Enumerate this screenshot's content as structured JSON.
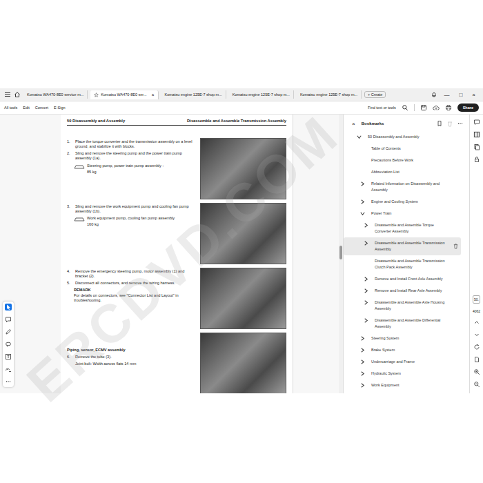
{
  "watermark": "ERCDVD.COM",
  "tabs": [
    {
      "label": "Komatsu WA470-8E0 service m...",
      "selected": false,
      "close": ""
    },
    {
      "label": "Komatsu WA470-8E0 ser...",
      "selected": true,
      "close": "×"
    },
    {
      "label": "Komatsu engine 125E-7 shop m...",
      "selected": false,
      "close": ""
    },
    {
      "label": "Komatsu engine 125E-7 shop m...",
      "selected": false,
      "close": ""
    },
    {
      "label": "Komatsu engine 125E-7 shop m...",
      "selected": false,
      "close": ""
    }
  ],
  "create": {
    "plus": "+",
    "label": "Create"
  },
  "window_controls": [
    "—",
    "□",
    "×"
  ],
  "menu": [
    "All tools",
    "Edit",
    "Convert",
    "E-Sign"
  ],
  "search": {
    "placeholder": "Find text or tools"
  },
  "share": "Share",
  "page": {
    "header_left": "50 Disassembly and Assembly",
    "header_right": "Disassemble and Assemble Transmission Assembly",
    "blocks": [
      {
        "items": [
          {
            "kind": "step",
            "num": "1.",
            "text": "Place the torque converter and the transmission assembly on a level ground, and stabilize it with blocks."
          },
          {
            "kind": "step",
            "num": "2.",
            "text": "Sling and remove the steering pump and the power train pump assembly (1a)."
          },
          {
            "kind": "weight",
            "label": "Steering pump, power train pump assembly :",
            "value": "85 kg"
          }
        ]
      },
      {
        "items": [
          {
            "kind": "step",
            "num": "3.",
            "text": "Sling and remove the work equipment pump and cooling fan pump assembly (1b)."
          },
          {
            "kind": "weight",
            "label": "Work equipment pump, cooling fan pump assembly",
            "value": "160 kg"
          }
        ]
      },
      {
        "items": [
          {
            "kind": "step",
            "num": "4.",
            "text": "Remove the emergency steering pump, motor assembly (1) and bracket (2)."
          },
          {
            "kind": "step",
            "num": "5.",
            "text": "Disconnect all connectors, and remove the wiring harness."
          },
          {
            "kind": "remark",
            "title": "REMARK",
            "text": "For details on connectors, see \"Connector List and Layout\" in troubleshooting."
          }
        ]
      },
      {
        "items": [
          {
            "kind": "heading",
            "text": "Piping, sensor, ECMV assembly"
          },
          {
            "kind": "step",
            "num": "6.",
            "text": "Remove the tube (3)."
          },
          {
            "kind": "note",
            "text": "Joint bolt: Width across flats 14 mm"
          }
        ]
      }
    ]
  },
  "bookmarks": {
    "title": "Bookmarks",
    "close": "×",
    "items": [
      {
        "label": "50 Disassembly and Assembly",
        "expandable": true,
        "expanded": true,
        "selected": false,
        "children": [
          {
            "label": "Table of Contents",
            "expandable": false,
            "expanded": false,
            "selected": false,
            "children": []
          },
          {
            "label": "Precautions Before Work",
            "expandable": false,
            "expanded": false,
            "selected": false,
            "children": []
          },
          {
            "label": "Abbreviation List",
            "expandable": false,
            "expanded": false,
            "selected": false,
            "children": []
          },
          {
            "label": "Related Information on Disassembly and Assembly",
            "expandable": true,
            "expanded": false,
            "selected": false,
            "children": []
          },
          {
            "label": "Engine and Cooling System",
            "expandable": true,
            "expanded": false,
            "selected": false,
            "children": []
          },
          {
            "label": "Power Train",
            "expandable": true,
            "expanded": true,
            "selected": false,
            "children": [
              {
                "label": "Disassemble and Assemble Torque Converter Assembly",
                "expandable": true,
                "expanded": false,
                "selected": false,
                "children": []
              },
              {
                "label": "Disassemble and Assemble Transmission Assembly",
                "expandable": true,
                "expanded": false,
                "selected": true,
                "children": []
              },
              {
                "label": "Disassemble and Assemble Transmission Clutch Pack Assembly",
                "expandable": false,
                "expanded": false,
                "selected": false,
                "children": []
              },
              {
                "label": "Remove and Install Front Axle Assembly",
                "expandable": true,
                "expanded": false,
                "selected": false,
                "children": []
              },
              {
                "label": "Remove and Install Rear Axle Assembly",
                "expandable": true,
                "expanded": false,
                "selected": false,
                "children": []
              },
              {
                "label": "Disassemble and Assemble Axle Housing Assembly",
                "expandable": true,
                "expanded": false,
                "selected": false,
                "children": []
              },
              {
                "label": "Disassemble and Assemble Differential Assembly",
                "expandable": true,
                "expanded": false,
                "selected": false,
                "children": []
              }
            ]
          },
          {
            "label": "Steering System",
            "expandable": true,
            "expanded": false,
            "selected": false,
            "children": []
          },
          {
            "label": "Brake System",
            "expandable": true,
            "expanded": false,
            "selected": false,
            "children": []
          },
          {
            "label": "Undercarriage and Frame",
            "expandable": true,
            "expanded": false,
            "selected": false,
            "children": []
          },
          {
            "label": "Hydraulic System",
            "expandable": true,
            "expanded": false,
            "selected": false,
            "children": []
          },
          {
            "label": "Work Equipment",
            "expandable": true,
            "expanded": false,
            "selected": false,
            "children": []
          }
        ]
      }
    ]
  },
  "pager": {
    "page": "50.",
    "total": "4062"
  }
}
